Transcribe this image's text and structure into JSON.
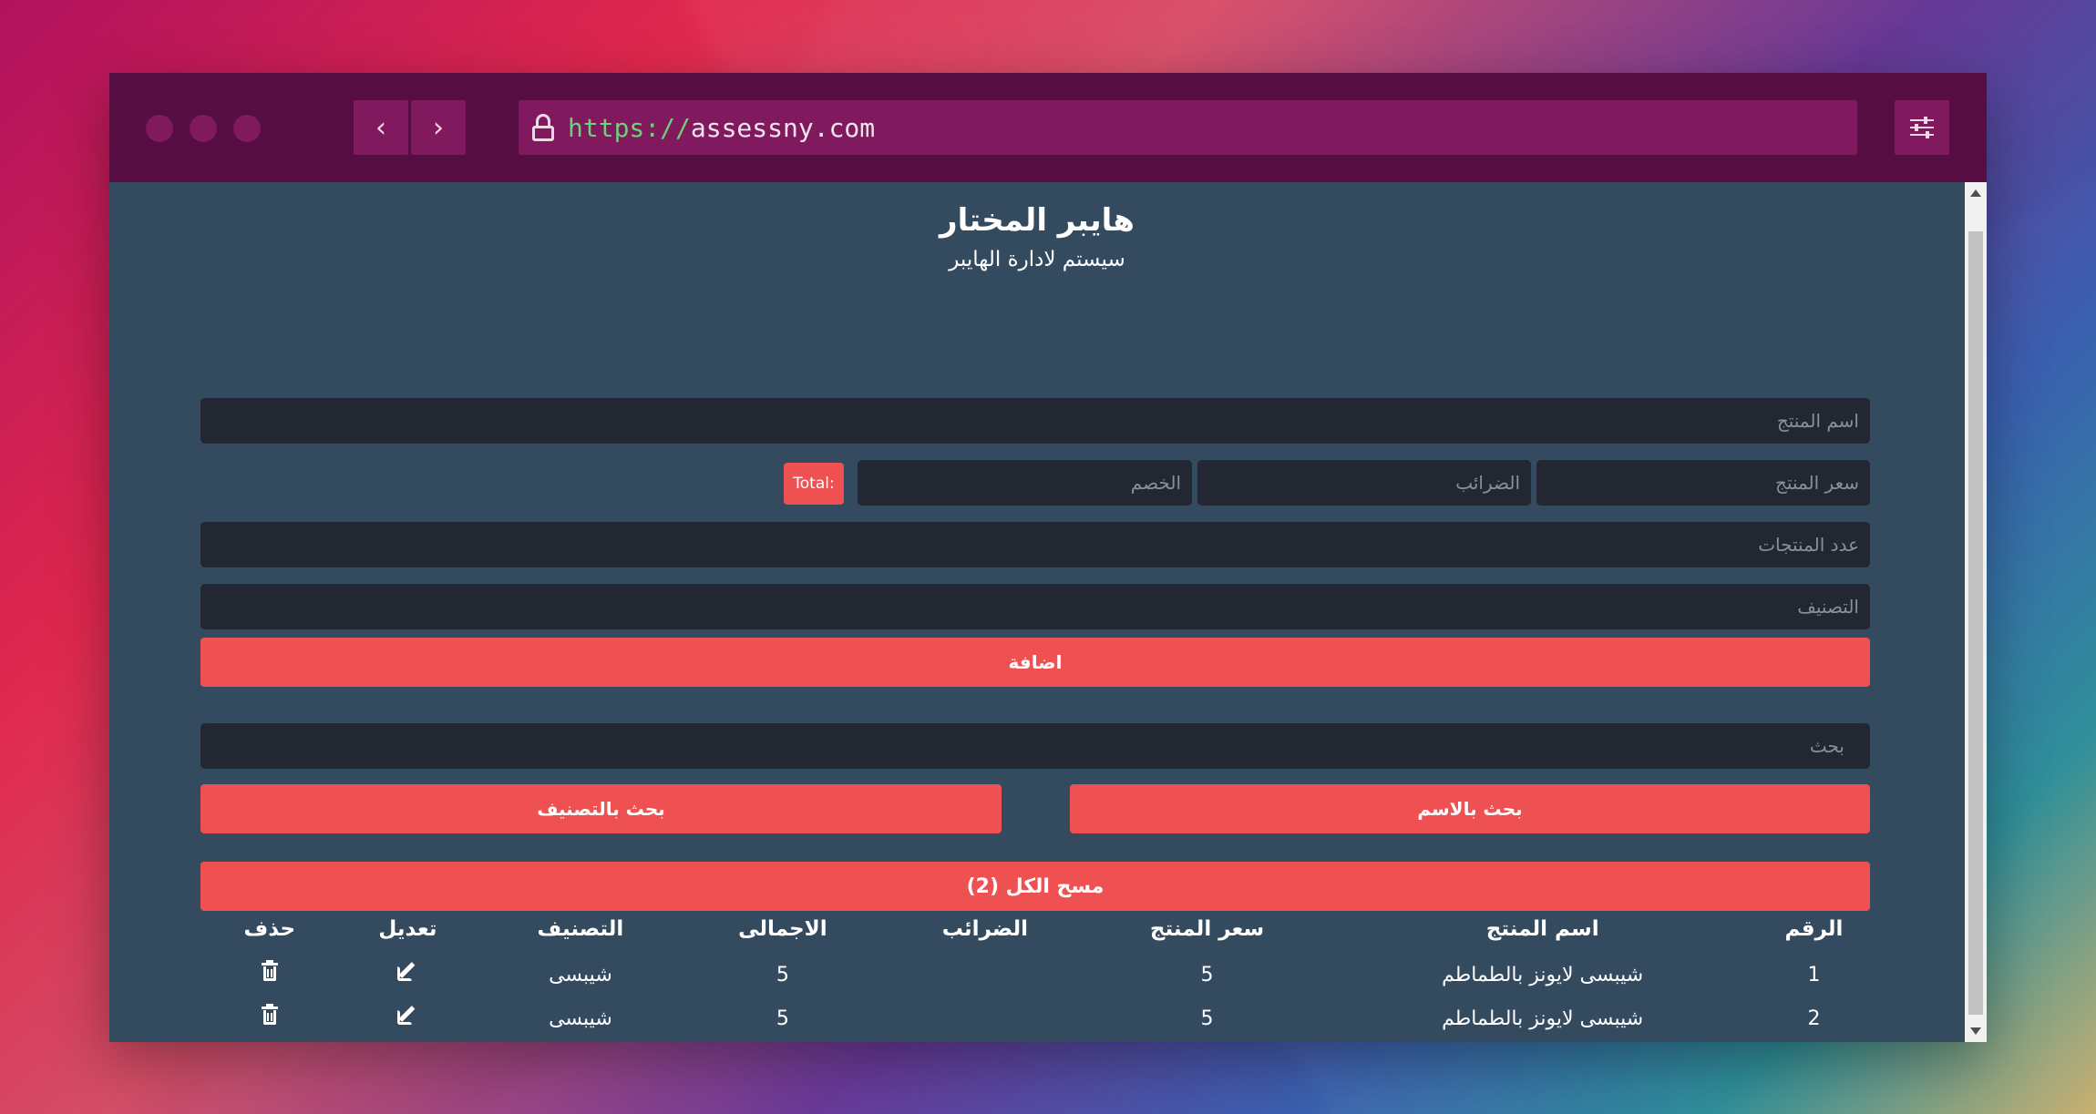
{
  "browser": {
    "url_scheme": "https://",
    "url_host": "assessny.com",
    "back_icon": "chevron-left-icon",
    "forward_icon": "chevron-right-icon",
    "settings_icon": "sliders-icon"
  },
  "header": {
    "title": "هايبر المختار",
    "subtitle": "سيستم لادارة الهايبر"
  },
  "form": {
    "product_name_placeholder": "اسم المنتج",
    "price_placeholder": "سعر المنتج",
    "taxes_placeholder": "الضرائب",
    "discount_placeholder": "الخصم",
    "total_label": "Total:",
    "count_placeholder": "عدد المنتجات",
    "category_placeholder": "التصنيف",
    "add_button": "اضافة"
  },
  "search": {
    "placeholder": "بحث",
    "by_name_button": "بحث بالاسم",
    "by_category_button": "بحث بالتصنيف",
    "clear_all_button": "مسح الكل (2)"
  },
  "table": {
    "headers": [
      "الرقم",
      "اسم المنتج",
      "سعر المنتج",
      "الضرائب",
      "الاجمالى",
      "التصنيف",
      "تعديل",
      "حذف"
    ],
    "rows": [
      {
        "id": "1",
        "name": "شيبسى لايونز بالطماطم",
        "price": "5",
        "taxes": "",
        "total": "5",
        "category": "شيبسى"
      },
      {
        "id": "2",
        "name": "شيبسى لايونز بالطماطم",
        "price": "5",
        "taxes": "",
        "total": "5",
        "category": "شيبسى"
      }
    ]
  },
  "colors": {
    "titlebar": "#560d41",
    "page_bg": "#334a5f",
    "input_bg": "#222731",
    "accent": "#ef5152"
  }
}
